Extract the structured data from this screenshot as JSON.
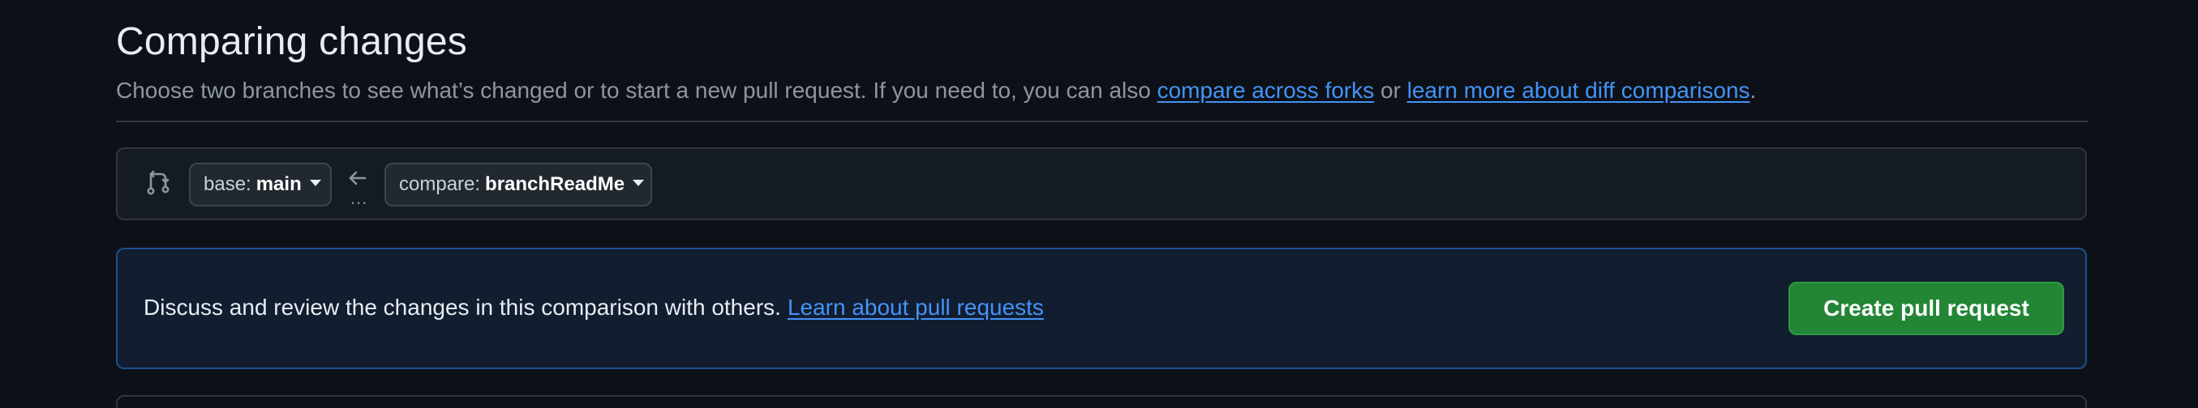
{
  "header": {
    "title": "Comparing changes",
    "subtitle_text": "Choose two branches to see what’s changed or to start a new pull request. If you need to, you can also ",
    "link_compare_forks": "compare across forks",
    "subtitle_or": " or ",
    "link_diff_comparisons": "learn more about diff comparisons",
    "subtitle_end": "."
  },
  "range": {
    "base_label": "base:",
    "base_value": "main",
    "arrow_icon": "arrow-left-icon",
    "dots": "...",
    "compare_label": "compare:",
    "compare_value": "branchReadMe"
  },
  "info": {
    "text": "Discuss and review the changes in this comparison with others.",
    "link": "Learn about pull requests",
    "create_button": "Create pull request"
  },
  "colors": {
    "background": "#0d1117",
    "accent_link": "#4493f8",
    "primary_button": "#238636"
  }
}
